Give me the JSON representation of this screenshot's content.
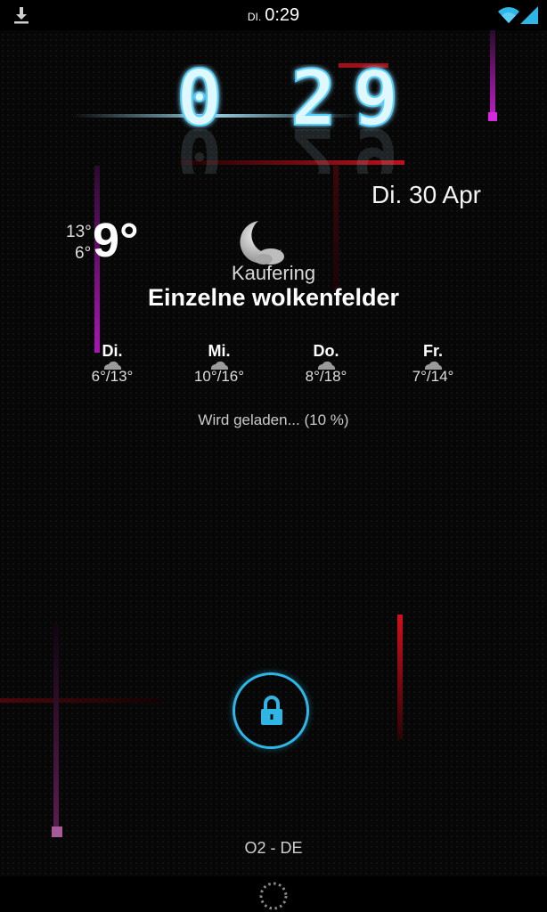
{
  "status_bar": {
    "day": "DI.",
    "time": "0:29",
    "icons": [
      "download-icon",
      "wifi-icon",
      "signal-icon"
    ]
  },
  "clock": {
    "hour": "0",
    "minutes": "29",
    "date": "Di. 30 Apr"
  },
  "weather": {
    "high": "13°",
    "low": "6°",
    "current": "9°",
    "location": "Kaufering",
    "condition": "Einzelne wolkenfelder",
    "condition_icon": "moon-cloud-icon",
    "forecast": [
      {
        "day": "Di.",
        "range": "6°/13°",
        "icon": "cloud-icon"
      },
      {
        "day": "Mi.",
        "range": "10°/16°",
        "icon": "cloud-icon"
      },
      {
        "day": "Do.",
        "range": "8°/18°",
        "icon": "cloud-icon"
      },
      {
        "day": "Fr.",
        "range": "7°/14°",
        "icon": "cloud-icon"
      }
    ]
  },
  "loading_text": "Wird geladen... (10 %)",
  "carrier": "O2 - DE",
  "colors": {
    "accent": "#2eb7e6",
    "neon_red": "#c0121c",
    "neon_magenta": "#b01fb8",
    "clock_cyan": "#9fe8ff"
  }
}
